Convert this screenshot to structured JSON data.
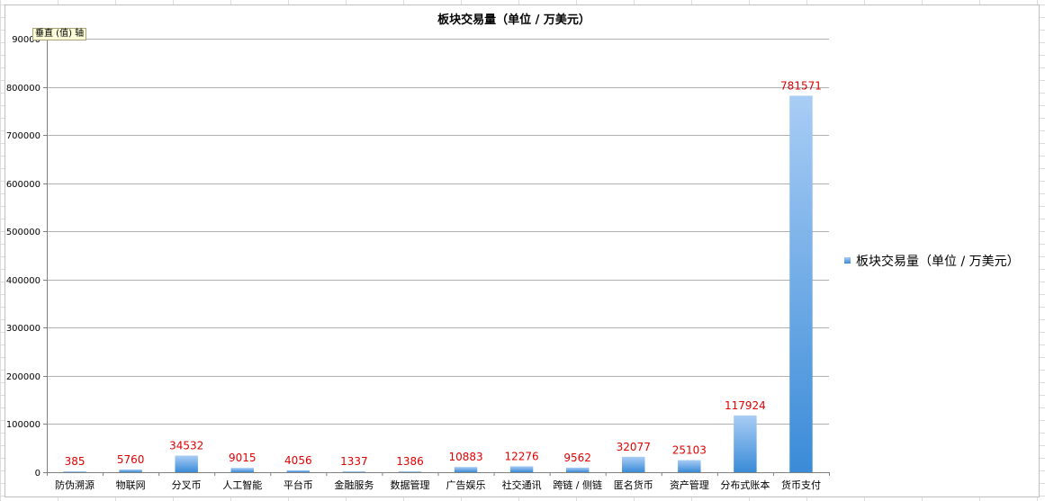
{
  "tooltip": "垂直 (值) 轴",
  "chart_data": {
    "type": "bar",
    "title": "板块交易量（单位 / 万美元）",
    "categories": [
      "防伪溯源",
      "物联网",
      "分叉币",
      "人工智能",
      "平台币",
      "金融服务",
      "数据管理",
      "广告娱乐",
      "社交通讯",
      "跨链 / 侧链",
      "匿名货币",
      "资产管理",
      "分布式账本",
      "货币支付"
    ],
    "series": [
      {
        "name": "板块交易量（单位 / 万美元）",
        "values": [
          385,
          5760,
          34532,
          9015,
          4056,
          1337,
          1386,
          10883,
          12276,
          9562,
          32077,
          25103,
          117924,
          781571
        ]
      }
    ],
    "ylim": [
      0,
      900000
    ],
    "yticks": [
      "0",
      "100000",
      "200000",
      "300000",
      "400000",
      "500000",
      "600000",
      "700000",
      "800000",
      "90000"
    ],
    "grid": true,
    "legend": "right",
    "data_label_color": "#e00000",
    "bar_color": "#5b9bd5"
  }
}
